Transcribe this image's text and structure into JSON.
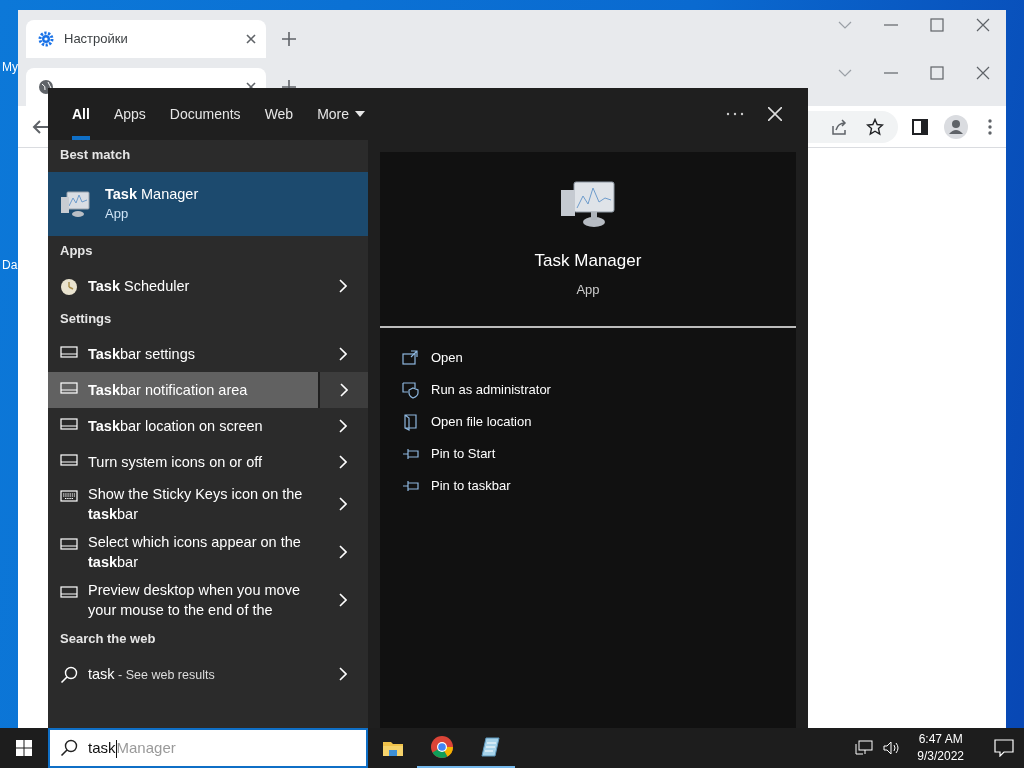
{
  "desktop_icons": [
    {
      "label": "My"
    },
    {
      "label": "Da"
    }
  ],
  "browser_windows": [
    {
      "tabs": [
        {
          "label": "Настройки",
          "kind": "settings"
        }
      ]
    },
    {
      "tabs": [
        {
          "kind": "web"
        }
      ]
    }
  ],
  "search_panel": {
    "filters": [
      {
        "label": "All",
        "selected": true
      },
      {
        "label": "Apps",
        "selected": false
      },
      {
        "label": "Documents",
        "selected": false
      },
      {
        "label": "Web",
        "selected": false
      },
      {
        "label": "More",
        "selected": false
      }
    ],
    "sections": [
      {
        "heading": "Best match",
        "items": [
          {
            "kind": "task-manager",
            "text": "**Task** Manager",
            "subtitle": "App",
            "selected": true,
            "hovered": false
          }
        ]
      },
      {
        "heading": "Apps",
        "items": [
          {
            "kind": "scheduler",
            "text": "**Task** Scheduler",
            "selected": false,
            "hovered": false
          }
        ]
      },
      {
        "heading": "Settings",
        "items": [
          {
            "kind": "display",
            "text": "**Task**bar settings",
            "selected": false,
            "hovered": false
          },
          {
            "kind": "display",
            "text": "**Task**bar notification area",
            "selected": false,
            "hovered": true
          },
          {
            "kind": "display",
            "text": "**Task**bar location on screen",
            "selected": false,
            "hovered": false
          },
          {
            "kind": "display",
            "text": "Turn system icons on or off",
            "selected": false,
            "hovered": false
          },
          {
            "kind": "keyboard",
            "text": "Show the Sticky Keys icon on the **task**bar",
            "selected": false,
            "hovered": false
          },
          {
            "kind": "display",
            "text": "Select which icons appear on the **task**bar",
            "selected": false,
            "hovered": false
          },
          {
            "kind": "display",
            "text": "Preview desktop when you move your mouse to the end of the",
            "selected": false,
            "hovered": false
          }
        ]
      },
      {
        "heading": "Search the web",
        "items": [
          {
            "kind": "web",
            "text": "task",
            "suffix": "- See web results",
            "selected": false,
            "hovered": false
          }
        ]
      }
    ],
    "preview": {
      "title": "Task Manager",
      "subtitle": "App",
      "actions": [
        {
          "kind": "open",
          "label": "Open"
        },
        {
          "kind": "admin",
          "label": "Run as administrator"
        },
        {
          "kind": "folder",
          "label": "Open file location"
        },
        {
          "kind": "pin",
          "label": "Pin to Start"
        },
        {
          "kind": "pin",
          "label": "Pin to taskbar"
        }
      ]
    },
    "search_box": {
      "value": "task",
      "suggestion": "Manager"
    }
  },
  "taskbar": {
    "apps": [
      {
        "kind": "explorer",
        "running": false
      },
      {
        "kind": "browser",
        "running": true
      },
      {
        "kind": "notepad",
        "running": true
      }
    ],
    "time": "6:47 AM",
    "date": "9/3/2022"
  }
}
